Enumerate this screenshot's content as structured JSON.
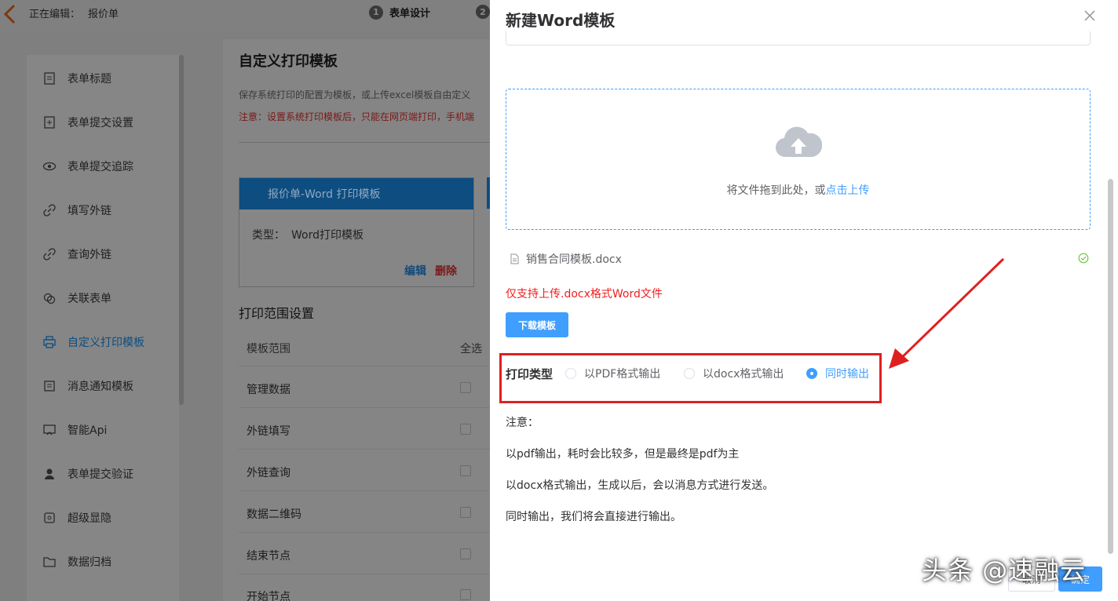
{
  "topbar": {
    "editing_label": "正在编辑：",
    "document_name": "报价单",
    "step1_num": "1",
    "step1_label": "表单设计",
    "step2_num": "2"
  },
  "sidebar": {
    "items": [
      {
        "label": "表单标题",
        "icon": "doc-icon"
      },
      {
        "label": "表单提交设置",
        "icon": "file-plus-icon"
      },
      {
        "label": "表单提交追踪",
        "icon": "eye-icon"
      },
      {
        "label": "填写外链",
        "icon": "link-icon"
      },
      {
        "label": "查询外链",
        "icon": "link-icon"
      },
      {
        "label": "关联表单",
        "icon": "circles-icon"
      },
      {
        "label": "自定义打印模板",
        "icon": "printer-icon",
        "active": true
      },
      {
        "label": "消息通知模板",
        "icon": "message-icon"
      },
      {
        "label": "智能Api",
        "icon": "api-icon"
      },
      {
        "label": "表单提交验证",
        "icon": "user-icon"
      },
      {
        "label": "超级显隐",
        "icon": "visibility-icon"
      },
      {
        "label": "数据归档",
        "icon": "folder-icon"
      }
    ]
  },
  "main": {
    "title": "自定义打印模板",
    "description": "保存系统打印的配置为模板，或上传excel模板自由定义",
    "warning": "注意：设置系统打印模板后，只能在网页端打印，手机端",
    "card": {
      "header": "报价单-Word 打印模板",
      "type_label": "类型：",
      "type_value": "Word打印模板",
      "edit": "编辑",
      "delete": "删除"
    },
    "range_title": "打印范围设置",
    "col_scope": "模板范围",
    "col_all": "全选",
    "rows": [
      "管理数据",
      "外链填写",
      "外链查询",
      "数据二维码",
      "结束节点",
      "开始节点"
    ]
  },
  "drawer": {
    "title": "新建Word模板",
    "upload_text": "将文件拖到此处，或",
    "upload_link": "点击上传",
    "file_name": "销售合同模板.docx",
    "only_support": "仅支持上传.docx格式Word文件",
    "download_button": "下载模板",
    "print_type_label": "打印类型",
    "options": [
      {
        "label": "以PDF格式输出",
        "checked": false
      },
      {
        "label": "以docx格式输出",
        "checked": false
      },
      {
        "label": "同时输出",
        "checked": true
      }
    ],
    "notes": [
      "注意：",
      "以pdf输出，耗时会比较多，但是最终是pdf为主",
      "以docx格式输出，生成以后，会以消息方式进行发送。",
      "同时输出，我们将会直接进行输出。"
    ],
    "cancel": "取消",
    "confirm": "确定"
  },
  "watermark": "头条 @速融云",
  "colors": {
    "primary": "#409eff",
    "danger": "#f01e1e",
    "highlight_border": "#e02020",
    "overlay": "#7f7f7f"
  }
}
